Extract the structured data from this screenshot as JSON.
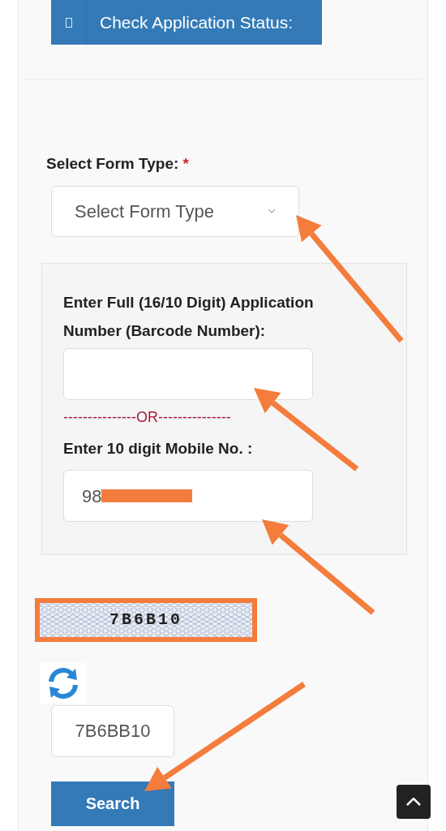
{
  "header_button": {
    "label": "Check Application Status:"
  },
  "form_type": {
    "label": "Select Form Type:",
    "required_mark": "*",
    "placeholder": "Select Form Type"
  },
  "application_number": {
    "label": "Enter Full (16/10 Digit) Application Number (Barcode Number):"
  },
  "separator": "---------------OR---------------",
  "mobile": {
    "label": "Enter 10 digit Mobile No. :",
    "value": "98",
    "redacted": true
  },
  "captcha": {
    "code": "7B6B10",
    "highlighted": true
  },
  "captcha_input": {
    "value": "7B6BB10"
  },
  "search_button": {
    "label": "Search"
  }
}
